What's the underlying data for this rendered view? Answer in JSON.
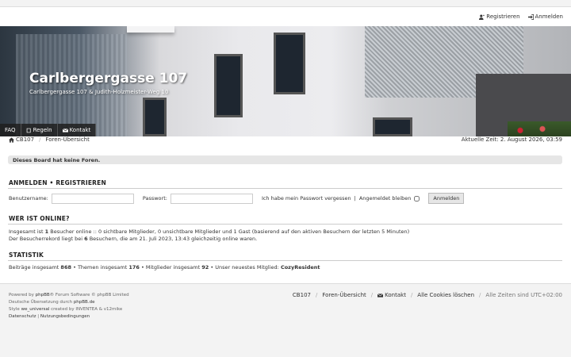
{
  "header": {
    "register": "Registrieren",
    "login": "Anmelden",
    "site_title": "Carlbergergasse 107",
    "site_desc": "Carlbergergasse 107 & Judith-Holzmeister-Weg 10"
  },
  "nav": {
    "faq": "FAQ",
    "rules": "Regeln",
    "contact": "Kontakt"
  },
  "breadcrumb": {
    "home": "CB107",
    "index": "Foren-Übersicht"
  },
  "current_time": "Aktuelle Zeit: 2. August 2026, 03:59",
  "notice": "Dieses Board hat keine Foren.",
  "login_section": {
    "title_login": "ANMELDEN",
    "bullet": "•",
    "title_register": "REGISTRIEREN",
    "username_label": "Benutzername:",
    "password_label": "Passwort:",
    "forgot": "Ich habe mein Passwort vergessen",
    "pipe": "|",
    "remember": "Angemeldet bleiben",
    "button": "Anmelden"
  },
  "online": {
    "title": "WER IST ONLINE?",
    "line1_a": "Insgesamt ist ",
    "line1_n": "1",
    "line1_b": " Besucher online :: 0 sichtbare Mitglieder, 0 unsichtbare Mitglieder und 1 Gast (basierend auf den aktiven Besuchern der letzten 5 Minuten)",
    "line2_a": "Der Besucherrekord liegt bei ",
    "line2_n": "6",
    "line2_b": " Besuchern, die am 21. Juli 2023, 13:43 gleichzeitig online waren."
  },
  "stats": {
    "title": "STATISTIK",
    "posts_label": "Beiträge insgesamt ",
    "posts": "868",
    "topics_label": " • Themen insgesamt ",
    "topics": "176",
    "members_label": " • Mitglieder insgesamt ",
    "members": "92",
    "newest_label": " • Unser neuestes Mitglied: ",
    "newest": "CozyResident"
  },
  "footer": {
    "powered_a": "Powered by ",
    "phpbb": "phpBB",
    "powered_b": "® Forum Software © phpBB Limited",
    "translation_a": "Deutsche Übersetzung durch ",
    "translation_link": "phpBB.de",
    "style_a": "Style ",
    "style_name": "we_universal",
    "style_b": " created by INVENTEA & v12mike",
    "privacy": "Datenschutz",
    "pipe": "|",
    "terms": "Nutzungsbedingungen"
  },
  "footnav": {
    "home": "CB107",
    "index": "Foren-Übersicht",
    "contact": "Kontakt",
    "cookies": "Alle Cookies löschen",
    "timezone": "Alle Zeiten sind UTC+02:00"
  },
  "icons": [
    "register-icon",
    "login-icon",
    "book-icon",
    "envelope-icon",
    "home-icon"
  ]
}
